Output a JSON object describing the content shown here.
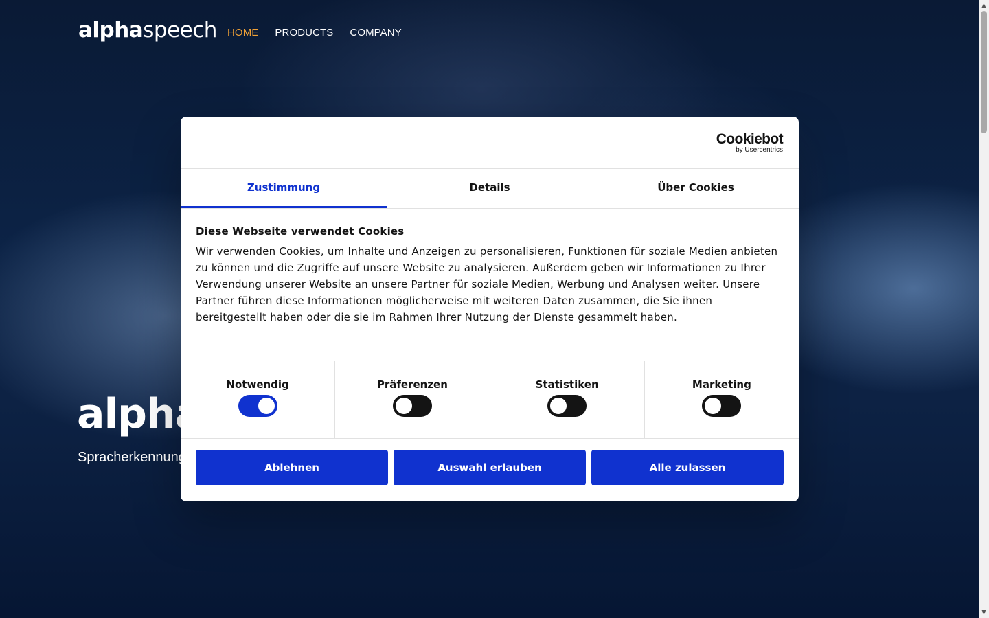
{
  "header": {
    "logo_bold": "alpha",
    "logo_light": "speech",
    "nav": [
      {
        "label": "HOME",
        "active": true
      },
      {
        "label": "PRODUCTS",
        "active": false
      },
      {
        "label": "COMPANY",
        "active": false
      }
    ]
  },
  "hero": {
    "title": "alpha",
    "subtitle": "Spracherkennung"
  },
  "cookie_dialog": {
    "brand": "Cookiebot",
    "brand_by": "by Usercentrics",
    "tabs": [
      {
        "label": "Zustimmung",
        "active": true
      },
      {
        "label": "Details",
        "active": false
      },
      {
        "label": "Über Cookies",
        "active": false
      }
    ],
    "heading": "Diese Webseite verwendet Cookies",
    "text": "Wir verwenden Cookies, um Inhalte und Anzeigen zu personalisieren, Funktionen für soziale Medien anbieten zu können und die Zugriffe auf unsere Website zu analysieren. Außerdem geben wir Informationen zu Ihrer Verwendung unserer Website an unsere Partner für soziale Medien, Werbung und Analysen weiter. Unsere Partner führen diese Informationen möglicherweise mit weiteren Daten zusammen, die Sie ihnen bereitgestellt haben oder die sie im Rahmen Ihrer Nutzung der Dienste gesammelt haben.",
    "categories": [
      {
        "label": "Notwendig",
        "enabled": true
      },
      {
        "label": "Präferenzen",
        "enabled": false
      },
      {
        "label": "Statistiken",
        "enabled": false
      },
      {
        "label": "Marketing",
        "enabled": false
      }
    ],
    "buttons": {
      "decline": "Ablehnen",
      "allow_selection": "Auswahl erlauben",
      "allow_all": "Alle zulassen"
    }
  },
  "colors": {
    "accent_blue": "#1032cf",
    "nav_active": "#f0a136",
    "background_navy": "#0c2346"
  }
}
